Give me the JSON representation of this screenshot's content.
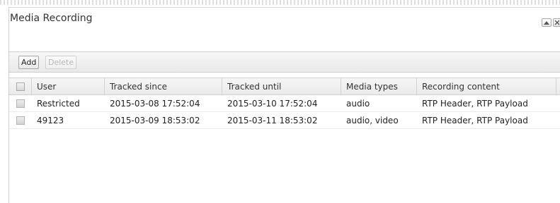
{
  "panel": {
    "title": "Media Recording"
  },
  "toolbar": {
    "add_label": "Add",
    "delete_label": "Delete"
  },
  "table": {
    "columns": [
      "User",
      "Tracked since",
      "Tracked until",
      "Media types",
      "Recording content"
    ],
    "rows": [
      {
        "user": "Restricted",
        "tracked_since": "2015-03-08 17:52:04",
        "tracked_until": "2015-03-10 17:52:04",
        "media_types": "audio",
        "recording_content": "RTP Header, RTP Payload"
      },
      {
        "user": "49123",
        "tracked_since": "2015-03-09 18:53:02",
        "tracked_until": "2015-03-11 18:53:02",
        "media_types": "audio, video",
        "recording_content": "RTP Header, RTP Payload"
      }
    ]
  },
  "icons": {
    "collapse": "collapse-icon",
    "close": "close-icon"
  }
}
